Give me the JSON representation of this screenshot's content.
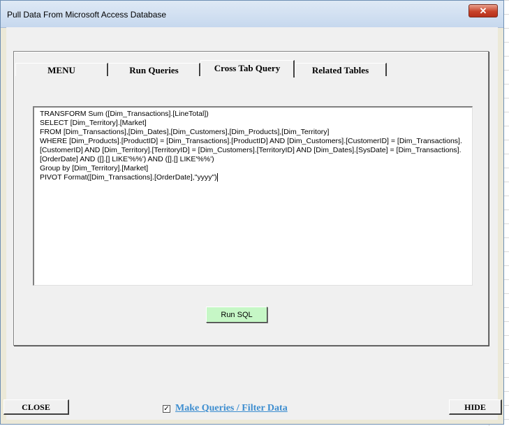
{
  "window": {
    "title": "Pull Data From Microsoft Access Database",
    "close_glyph": "✕"
  },
  "tabs": [
    {
      "label": "MENU"
    },
    {
      "label": "Run Queries"
    },
    {
      "label": "Cross Tab Query",
      "active": true
    },
    {
      "label": "Related Tables"
    }
  ],
  "cross_tab": {
    "sql_text": "TRANSFORM Sum ([Dim_Transactions].[LineTotal])\nSELECT [Dim_Territory].[Market]\nFROM [Dim_Transactions],[Dim_Dates],[Dim_Customers],[Dim_Products],[Dim_Territory]\nWHERE [Dim_Products].[ProductID] = [Dim_Transactions].[ProductID] AND [Dim_Customers].[CustomerID] = [Dim_Transactions].[CustomerID] AND [Dim_Territory].[TerritoryID] = [Dim_Customers].[TerritoryID] AND [Dim_Dates].[SysDate] = [Dim_Transactions].[OrderDate] AND ([].[] LIKE'%%') AND ([].[] LIKE'%%')\nGroup by [Dim_Territory].[Market]\nPIVOT Format([Dim_Transactions].[OrderDate],\"yyyy\")",
    "run_label": "Run SQL"
  },
  "footer": {
    "close_label": "CLOSE",
    "hide_label": "HIDE",
    "checkbox_checked": true,
    "check_glyph": "✓",
    "link_label": "Make Queries / Filter Data"
  },
  "colors": {
    "run_button": "#c6f7c6",
    "link": "#3e8ed0",
    "close_x": "#c7432a"
  }
}
